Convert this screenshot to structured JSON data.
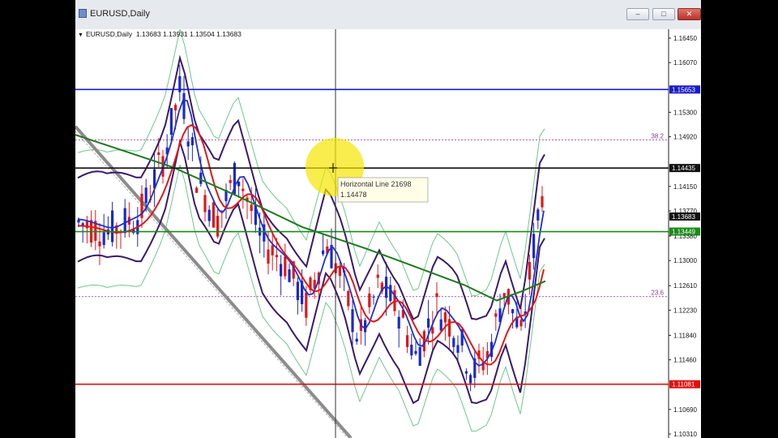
{
  "window": {
    "title": "EURUSD,Daily",
    "controls": {
      "minimize": "–",
      "maximize": "□",
      "close": "✕"
    }
  },
  "header": {
    "symbol": "EURUSD,Daily",
    "open": "1.13683",
    "high": "1.13931",
    "low": "1.13504",
    "close": "1.13683"
  },
  "price_axis": {
    "ticks": [
      "1.16450",
      "1.16070",
      "1.15300",
      "1.14920",
      "1.14150",
      "1.13770",
      "1.13380",
      "1.13000",
      "1.12610",
      "1.12230",
      "1.11840",
      "1.11460",
      "1.10690",
      "1.10310"
    ],
    "labels": [
      {
        "text": "1.15653",
        "color": "#1a1ac8",
        "value": 1.15653
      },
      {
        "text": "1.14435",
        "color": "#111111",
        "value": 1.14435
      },
      {
        "text": "1.13683",
        "color": "#111111",
        "value": 1.13683
      },
      {
        "text": "1.13449",
        "color": "#1a8a1a",
        "value": 1.13449
      },
      {
        "text": "1.11081",
        "color": "#e01010",
        "value": 1.11081
      }
    ]
  },
  "horizontal_lines": [
    {
      "value": 1.15653,
      "color": "#1a1ac8"
    },
    {
      "value": 1.14435,
      "color": "#111111"
    },
    {
      "value": 1.13449,
      "color": "#1a8a1a"
    },
    {
      "value": 1.11081,
      "color": "#e01010"
    }
  ],
  "fib_levels": [
    {
      "label": "38.2",
      "value": 1.1487
    },
    {
      "label": "23.6",
      "value": 1.1244
    }
  ],
  "tooltip": {
    "line1": "Horizontal Line 21698",
    "line2": "1.14478"
  },
  "colors": {
    "bull": "#1a2ac8",
    "bear": "#e01818",
    "ma_red": "#e01818",
    "ma_blue": "#2030c8",
    "ma_green": "#1f7a1f",
    "band_dark": "#3a1a6a",
    "band_light": "#6cc98a",
    "trendline": "#8c8c8c"
  }
}
